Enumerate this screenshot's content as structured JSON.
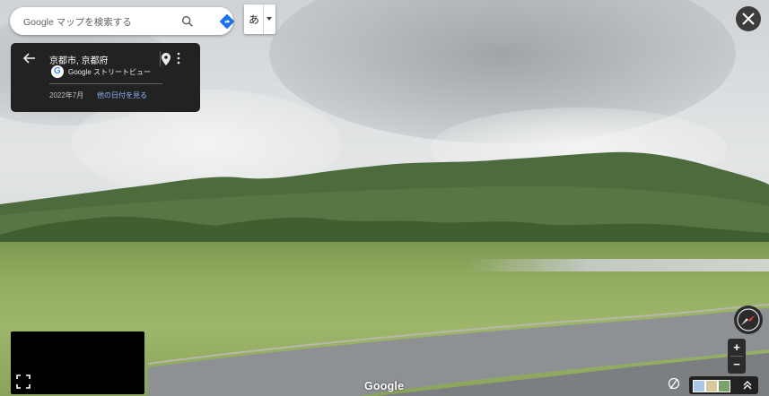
{
  "search": {
    "placeholder": "Google マップを検索する"
  },
  "ime": {
    "label": "あ"
  },
  "card": {
    "place": "京都市, 京都府",
    "service": "Google ストリートビュー",
    "date": "2022年7月",
    "other_dates": "他の日付を見る"
  },
  "watermark": "Google",
  "zoom": {
    "in": "+",
    "out": "−"
  },
  "icons": {
    "search": "search-icon",
    "directions": "directions-icon",
    "close": "close-icon",
    "back": "arrow-back-icon",
    "pin": "location-pin-icon",
    "more": "more-vert-icon",
    "expand": "fullscreen-icon",
    "compass": "compass-icon",
    "pegman": "pegman-icon",
    "layers": "chevron-up-icon"
  },
  "colors": {
    "card_bg": "#222222",
    "link": "#8ab4f8",
    "directions": "#1a73e8"
  }
}
